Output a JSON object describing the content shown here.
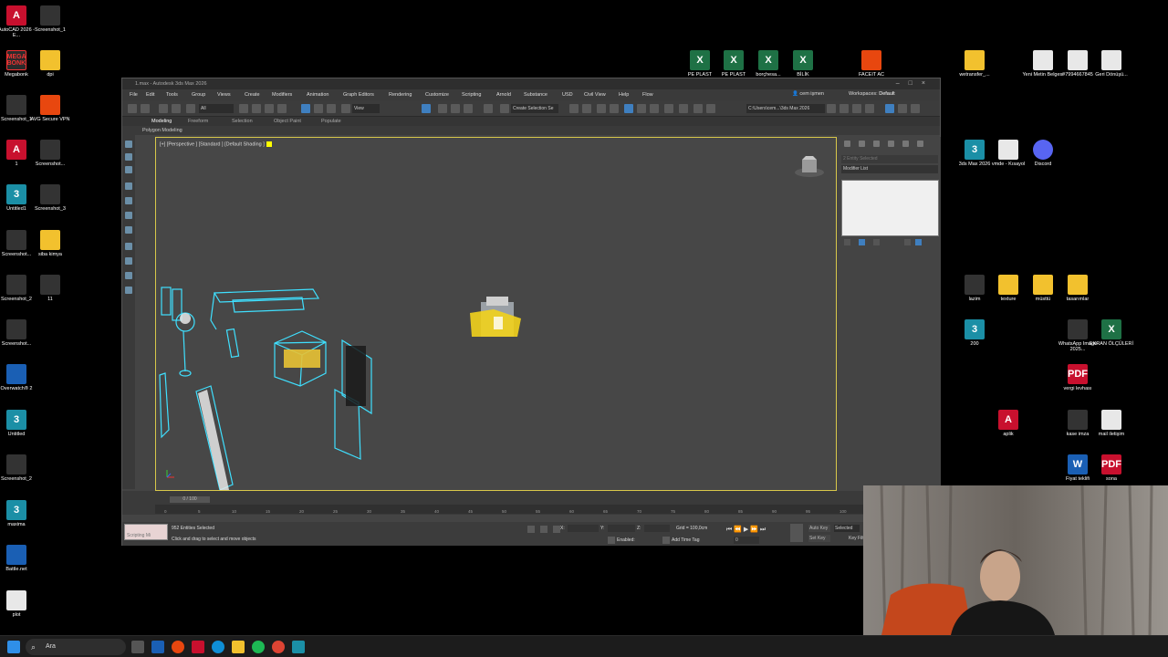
{
  "desktop": {
    "left_icons": [
      {
        "label": "AutoCAD 2026 - E...",
        "icon": "autocad-icon",
        "badge": "A"
      },
      {
        "label": "Screenshot_1",
        "icon": "image-file-icon",
        "badge": ""
      },
      {
        "label": "Megabonk",
        "icon": "megabonk-icon",
        "badge": "MEGA BONK"
      },
      {
        "label": "dpi",
        "icon": "folder-icon",
        "badge": ""
      },
      {
        "label": "Screenshot_1",
        "icon": "image-file-icon",
        "badge": ""
      },
      {
        "label": "AVG Secure VPN",
        "icon": "avg-vpn-icon",
        "badge": ""
      },
      {
        "label": "1",
        "icon": "autocad-file-icon",
        "badge": "A"
      },
      {
        "label": "Screenshot...",
        "icon": "image-file-icon",
        "badge": ""
      },
      {
        "label": "Untitled1",
        "icon": "3dsmax-file-icon",
        "badge": "3"
      },
      {
        "label": "Screenshot_3",
        "icon": "image-file-icon",
        "badge": ""
      },
      {
        "label": "Screenshot...",
        "icon": "image-file-icon",
        "badge": ""
      },
      {
        "label": "siba kimya",
        "icon": "folder-icon",
        "badge": ""
      },
      {
        "label": "Screenshot_2",
        "icon": "image-file-icon",
        "badge": ""
      },
      {
        "label": "11",
        "icon": "image-file-icon",
        "badge": ""
      },
      {
        "label": "Screenshot...",
        "icon": "image-file-icon",
        "badge": ""
      },
      {
        "label": "Overwatch® 2",
        "icon": "overwatch-icon",
        "badge": ""
      },
      {
        "label": "Untitled",
        "icon": "3dsmax-file-icon",
        "badge": "3"
      },
      {
        "label": "Screenshot_2",
        "icon": "image-file-icon",
        "badge": ""
      },
      {
        "label": "maxima",
        "icon": "3dsmax-file-icon",
        "badge": "3"
      },
      {
        "label": "Battle.net",
        "icon": "battlenet-icon",
        "badge": ""
      },
      {
        "label": "plot",
        "icon": "document-icon",
        "badge": ""
      }
    ],
    "right_icons": [
      {
        "label": "wetransfer_...",
        "icon": "folder-icon",
        "badge": ""
      },
      {
        "label": "Yeni Metin Belgesi",
        "icon": "text-file-icon",
        "badge": ""
      },
      {
        "label": "#7994667845",
        "icon": "document-icon",
        "badge": ""
      },
      {
        "label": "Geri Dönüşü...",
        "icon": "recycle-bin-icon",
        "badge": ""
      },
      {
        "label": "3ds Max 2026",
        "icon": "3dsmax-icon",
        "badge": "3"
      },
      {
        "label": "vmde - Kısayol",
        "icon": "shortcut-icon",
        "badge": ""
      },
      {
        "label": "Discord",
        "icon": "discord-icon",
        "badge": ""
      },
      {
        "label": "lazim",
        "icon": "image-file-icon",
        "badge": ""
      },
      {
        "label": "texture",
        "icon": "folder-icon",
        "badge": ""
      },
      {
        "label": "müsttü",
        "icon": "folder-icon",
        "badge": ""
      },
      {
        "label": "tasarımlar",
        "icon": "folder-icon",
        "badge": ""
      },
      {
        "label": "200",
        "icon": "3dsmax-file-icon",
        "badge": "3"
      },
      {
        "label": "WhatsApp Image 2025...",
        "icon": "image-file-icon",
        "badge": ""
      },
      {
        "label": "EKRAN ÖLÇÜLERİ",
        "icon": "excel-icon",
        "badge": "X"
      },
      {
        "label": "vergi levhası",
        "icon": "pdf-icon",
        "badge": "PDF"
      },
      {
        "label": "aplik",
        "icon": "autocad-file-icon",
        "badge": "A"
      },
      {
        "label": "kase imza",
        "icon": "image-file-icon",
        "badge": ""
      },
      {
        "label": "mail iletişim",
        "icon": "document-icon",
        "badge": ""
      },
      {
        "label": "Fiyat teklifi",
        "icon": "word-icon",
        "badge": "W"
      },
      {
        "label": "sona",
        "icon": "pdf-icon",
        "badge": "PDF"
      }
    ],
    "top_icons": [
      {
        "label": "PE PLAST",
        "icon": "excel-icon",
        "badge": "X"
      },
      {
        "label": "PE PLAST",
        "icon": "excel-icon",
        "badge": "X"
      },
      {
        "label": "borçhesa...",
        "icon": "excel-icon",
        "badge": "X"
      },
      {
        "label": "BİLİK",
        "icon": "excel-icon",
        "badge": "X"
      },
      {
        "label": "FACEIT AC",
        "icon": "faceit-icon",
        "badge": ""
      }
    ]
  },
  "app": {
    "title": "1.max - Autodesk 3ds Max 2026",
    "menu": [
      "File",
      "Edit",
      "Tools",
      "Group",
      "Views",
      "Create",
      "Modifiers",
      "Animation",
      "Graph Editors",
      "Rendering",
      "Customize",
      "Scripting",
      "Arnold",
      "Substance",
      "USD",
      "Civil View",
      "Help",
      "Flow"
    ],
    "user": "cem işmen",
    "workspace_label": "Workspaces:",
    "workspace_value": "Default",
    "selection_set": "Create Selection Se",
    "view_dropdown": "View",
    "filter_dropdown": "All",
    "path": "C:\\Users\\cem...\\3ds Max 2026",
    "ribbon_tabs": [
      "Modeling",
      "Freeform",
      "Selection",
      "Object Paint",
      "Populate"
    ],
    "sub_ribbon": "Polygon Modeling",
    "viewport_label": "[+] [Perspective ] [Standard ] [Default Shading ]",
    "command_panel": {
      "selection_placeholder": "2 Entity Selected",
      "modifier_list": "Modifier List"
    },
    "timeline": {
      "position": "0 / 100",
      "ticks": [
        "0",
        "5",
        "10",
        "15",
        "20",
        "25",
        "30",
        "35",
        "40",
        "45",
        "50",
        "55",
        "60",
        "65",
        "70",
        "75",
        "80",
        "85",
        "90",
        "95",
        "100"
      ]
    },
    "status": {
      "maxscript": "Scripting Mi",
      "selected": "952 Entities Selected",
      "prompt": "Click and drag to select and move objects",
      "x_label": "X:",
      "y_label": "Y:",
      "z_label": "Z:",
      "grid": "Grid = 100,0cm",
      "enabled": "Enabled:",
      "add_time_tag": "Add Time Tag",
      "auto_key": "Auto Key",
      "set_key": "Set Key",
      "selected_dropdown": "Selected",
      "key_filters": "Key Filters...",
      "frame": "0"
    }
  },
  "taskbar": {
    "search_placeholder": "Ara"
  },
  "colors": {
    "selection_wire": "#3fe0ff",
    "yellow_object": "#f2d21c",
    "viewport_bg": "#474747",
    "viewport_border": "#d8c84a"
  }
}
